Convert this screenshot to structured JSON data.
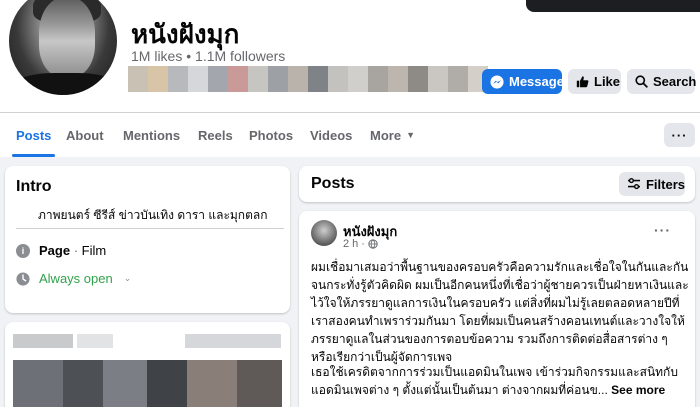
{
  "page": {
    "name": "หนังฝังมุก",
    "likes": "1M likes",
    "separator": "•",
    "followers": "1.1M followers"
  },
  "actions": {
    "message": "Message",
    "like": "Like",
    "search": "Search"
  },
  "nav": {
    "tabs": [
      "Posts",
      "About",
      "Mentions",
      "Reels",
      "Photos",
      "Videos",
      "More"
    ],
    "active": "Posts",
    "more_menu": "···"
  },
  "intro": {
    "title": "Intro",
    "bio": "ภาพยนตร์ ซีรีส์ ข่าวบันเทิง ดารา และมุกตลก",
    "category_label": "Page",
    "category_value": "Film",
    "category_sep": " · ",
    "hours": "Always open"
  },
  "posts": {
    "title": "Posts",
    "filters_label": "Filters",
    "items": [
      {
        "author": "หนังฝังมุก",
        "time": "2 h",
        "meta_sep": "·",
        "paragraph1": "ผมเชื่อมาเสมอว่าพื้นฐานของครอบครัวคือความรักและเชื่อใจในกันและกัน จนกระทั่งรู้ตัวคิดผิด ผมเป็นอีกคนหนึ่งที่เชื่อว่าผู้ชายควรเป็นฝ่ายหาเงินและไว้ใจให้ภรรยาดูแลการเงินในครอบครัว แต่สิ่งที่ผมไม่รู้เลยตลอดหลายปีที่เราสองคนทำเพราร่วมกันมา โดยที่ผมเป็นคนสร้างคอนเทนต์และวางใจให้ภรรยาดูแลในส่วนของการตอบข้อความ รวมถึงการติดต่อสื่อสารต่าง ๆ หรือเรียกว่าเป็นผู้จัดการเพจ",
        "paragraph2": "เธอใช้เครดิตจากการร่วมเป็นแอดมินในเพจ เข้าร่วมกิจกรรมและสนิทกับแอดมินเพจต่าง ๆ ตั้งแต่นั้นเป็นต้นมา ต่างจากผมที่ค่อนข...",
        "see_more": "See more"
      }
    ]
  },
  "colors": {
    "accent": "#1b74e4",
    "open_green": "#31a24c",
    "background": "#f0f2f5"
  },
  "icons": {
    "message": "messenger-icon",
    "like": "thumbs-up-icon",
    "search": "search-icon",
    "filters": "sliders-icon",
    "info": "info-icon",
    "clock": "clock-icon",
    "globe": "globe-icon",
    "more": "more-dots-icon"
  }
}
